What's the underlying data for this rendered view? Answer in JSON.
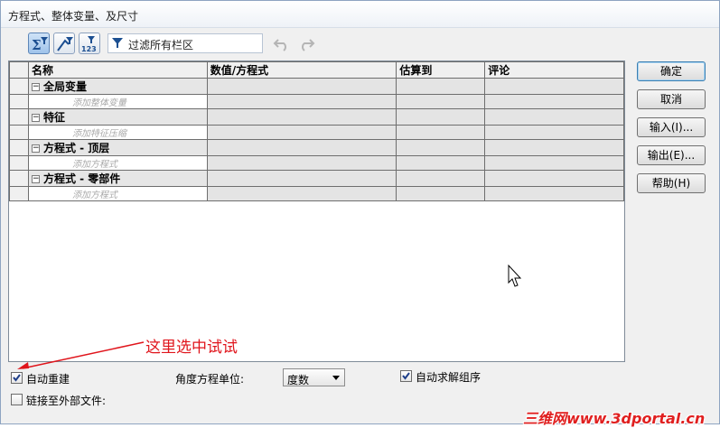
{
  "window": {
    "title": "方程式、整体变量、及尺寸"
  },
  "toolbar": {
    "filter_text": "过滤所有栏区"
  },
  "grid": {
    "columns": [
      "名称",
      "数值/方程式",
      "估算到",
      "评论"
    ],
    "groups": [
      {
        "label": "全局变量",
        "placeholder": "添加整体变量"
      },
      {
        "label": "特征",
        "placeholder": "添加特征压缩"
      },
      {
        "label": "方程式 - 顶层",
        "placeholder": "添加方程式"
      },
      {
        "label": "方程式 - 零部件",
        "placeholder": "添加方程式"
      }
    ]
  },
  "buttons": {
    "ok": "确定",
    "cancel": "取消",
    "import": "输入(I)...",
    "export": "输出(E)...",
    "help": "帮助(H)"
  },
  "bottom": {
    "auto_rebuild": "自动重建",
    "auto_rebuild_checked": true,
    "angle_unit_label": "角度方程单位:",
    "angle_unit_value": "度数",
    "auto_solve": "自动求解组序",
    "auto_solve_checked": true,
    "link_external": "链接至外部文件:",
    "link_external_checked": false
  },
  "annotation": "这里选中试试",
  "watermark": "三维网www.3dportal.cn",
  "colors": {
    "annotation": "#e0151c",
    "accent": "#3c7fb1"
  }
}
